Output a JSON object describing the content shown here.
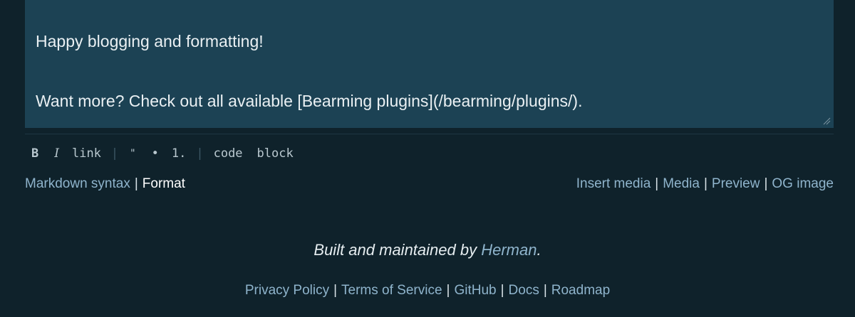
{
  "editor": {
    "line1": "Happy blogging and formatting!",
    "line2": "Want more? Check out all available [Bearming plugins](/bearming/plugins/)."
  },
  "toolbar": {
    "bold": "B",
    "italic": "I",
    "link": "link",
    "separator": "|",
    "quote": "\"",
    "bullet": "•",
    "ordered": "1.",
    "code": "code",
    "block": "block"
  },
  "left_links": {
    "markdown_syntax": "Markdown syntax",
    "format": "Format",
    "separator": "|"
  },
  "right_links": {
    "insert_media": "Insert media",
    "media": "Media",
    "preview": "Preview",
    "og_image": "OG image",
    "separator": "|"
  },
  "credit": {
    "prefix": "Built and maintained by",
    "author": "Herman",
    "suffix": "."
  },
  "footer": {
    "privacy": "Privacy Policy",
    "terms": "Terms of Service",
    "github": "GitHub",
    "docs": "Docs",
    "roadmap": "Roadmap",
    "separator": "|"
  },
  "colors": {
    "background": "#0f222b",
    "editor_background": "#1c4254",
    "link": "#8fb4cc"
  }
}
